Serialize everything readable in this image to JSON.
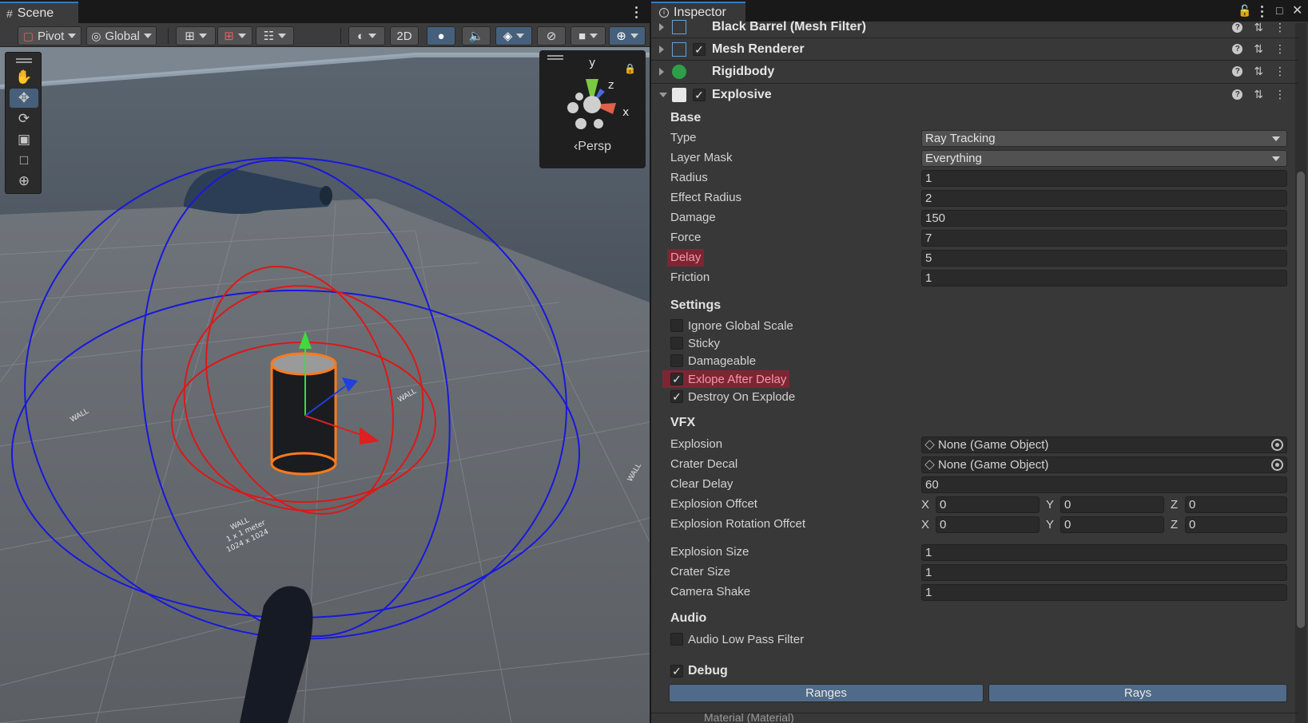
{
  "scene": {
    "tab_label": "Scene",
    "toolbar": {
      "pivot": "Pivot",
      "global": "Global",
      "mode_2d": "2D"
    },
    "gizmo": {
      "label": "‹Persp",
      "axis_y": "y",
      "axis_z": "z",
      "axis_x": "x"
    },
    "floor_labels": [
      "WALL",
      "1 x 1 meter",
      "1024 x 1024"
    ]
  },
  "inspector": {
    "tab_label": "Inspector",
    "components": [
      {
        "title": "Black Barrel (Mesh Filter)",
        "has_checkbox": false
      },
      {
        "title": "Mesh Renderer",
        "has_checkbox": true
      },
      {
        "title": "Rigidbody",
        "has_checkbox": false
      },
      {
        "title": "Explosive",
        "has_checkbox": true
      }
    ],
    "base": {
      "header": "Base",
      "type_label": "Type",
      "type_value": "Ray Tracking",
      "layer_label": "Layer Mask",
      "layer_value": "Everything",
      "radius_label": "Radius",
      "radius_value": "1",
      "effect_radius_label": "Effect Radius",
      "effect_radius_value": "2",
      "damage_label": "Damage",
      "damage_value": "150",
      "force_label": "Force",
      "force_value": "7",
      "delay_label": "Delay",
      "delay_value": "5",
      "friction_label": "Friction",
      "friction_value": "1"
    },
    "settings": {
      "header": "Settings",
      "items": [
        {
          "label": "Ignore Global Scale",
          "checked": false
        },
        {
          "label": "Sticky",
          "checked": false
        },
        {
          "label": "Damageable",
          "checked": false
        },
        {
          "label": "Exlope After Delay",
          "checked": true
        },
        {
          "label": "Destroy On Explode",
          "checked": true
        }
      ]
    },
    "vfx": {
      "header": "VFX",
      "explosion_label": "Explosion",
      "explosion_value": "None (Game Object)",
      "crater_label": "Crater Decal",
      "crater_value": "None (Game Object)",
      "clear_delay_label": "Clear Delay",
      "clear_delay_value": "60",
      "offset_label": "Explosion Offcet",
      "offset": {
        "x": "0",
        "y": "0",
        "z": "0"
      },
      "rot_offset_label": "Explosion Rotation Offcet",
      "rot_offset": {
        "x": "0",
        "y": "0",
        "z": "0"
      },
      "axis_x": "X",
      "axis_y": "Y",
      "axis_z": "Z",
      "size_label": "Explosion Size",
      "size_value": "1",
      "crater_size_label": "Crater Size",
      "crater_size_value": "1",
      "shake_label": "Camera Shake",
      "shake_value": "1"
    },
    "audio": {
      "header": "Audio",
      "low_pass_label": "Audio Low Pass Filter"
    },
    "debug": {
      "label": "Debug",
      "ranges_button": "Ranges",
      "rays_button": "Rays"
    },
    "next_component": "Material (Material)"
  }
}
